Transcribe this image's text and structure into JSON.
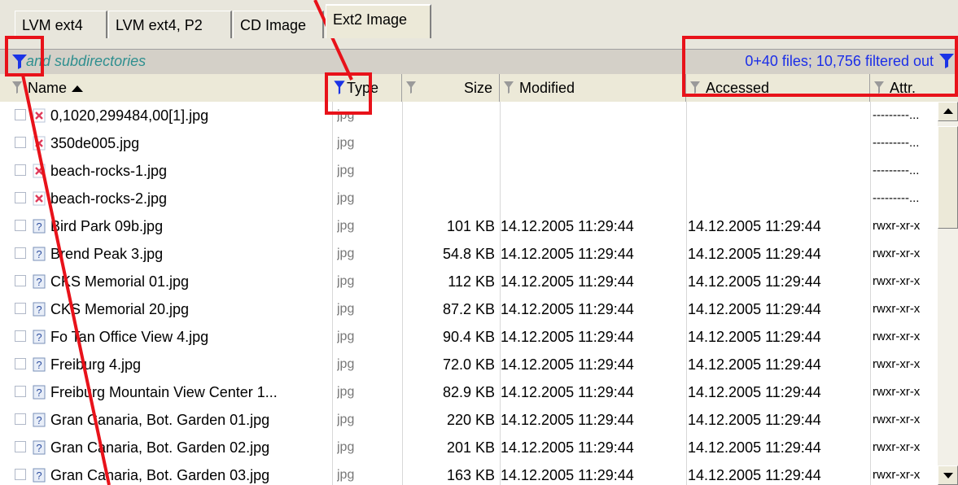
{
  "tabs": [
    {
      "label": "LVM ext4",
      "active": false
    },
    {
      "label": "LVM ext4, P2",
      "active": false
    },
    {
      "label": "CD Image",
      "active": false
    },
    {
      "label": "Ext2 Image",
      "active": true
    }
  ],
  "filter_bar": {
    "left_text": "and subdirectories",
    "right_text": "0+40 files; 10,756 filtered out",
    "funnel_color": "#1a33e6"
  },
  "columns": {
    "name": "Name",
    "type": "Type",
    "size": "Size",
    "modified": "Modified",
    "accessed": "Accessed",
    "attr": "Attr."
  },
  "rows": [
    {
      "status": "x-icon",
      "name": "0,1020,299484,00[1].jpg",
      "type": "jpg",
      "size": "",
      "modified": "",
      "accessed": "",
      "attr": "---------..."
    },
    {
      "status": "x-icon",
      "name": "350de005.jpg",
      "type": "jpg",
      "size": "",
      "modified": "",
      "accessed": "",
      "attr": "---------..."
    },
    {
      "status": "x-icon",
      "name": "beach-rocks-1.jpg",
      "type": "jpg",
      "size": "",
      "modified": "",
      "accessed": "",
      "attr": "---------..."
    },
    {
      "status": "x-icon",
      "name": "beach-rocks-2.jpg",
      "type": "jpg",
      "size": "",
      "modified": "",
      "accessed": "",
      "attr": "---------..."
    },
    {
      "status": "question-icon",
      "name": "Bird Park 09b.jpg",
      "type": "jpg",
      "size": "101 KB",
      "modified": "14.12.2005  11:29:44",
      "accessed": "14.12.2005  11:29:44",
      "attr": "rwxr-xr-x"
    },
    {
      "status": "question-icon",
      "name": "Brend Peak 3.jpg",
      "type": "jpg",
      "size": "54.8 KB",
      "modified": "14.12.2005  11:29:44",
      "accessed": "14.12.2005  11:29:44",
      "attr": "rwxr-xr-x"
    },
    {
      "status": "question-icon",
      "name": "CKS Memorial 01.jpg",
      "type": "jpg",
      "size": "112 KB",
      "modified": "14.12.2005  11:29:44",
      "accessed": "14.12.2005  11:29:44",
      "attr": "rwxr-xr-x"
    },
    {
      "status": "question-icon",
      "name": "CKS Memorial 20.jpg",
      "type": "jpg",
      "size": "87.2 KB",
      "modified": "14.12.2005  11:29:44",
      "accessed": "14.12.2005  11:29:44",
      "attr": "rwxr-xr-x"
    },
    {
      "status": "question-icon",
      "name": "Fo Tan Office View 4.jpg",
      "type": "jpg",
      "size": "90.4 KB",
      "modified": "14.12.2005  11:29:44",
      "accessed": "14.12.2005  11:29:44",
      "attr": "rwxr-xr-x"
    },
    {
      "status": "question-icon",
      "name": "Freiburg 4.jpg",
      "type": "jpg",
      "size": "72.0 KB",
      "modified": "14.12.2005  11:29:44",
      "accessed": "14.12.2005  11:29:44",
      "attr": "rwxr-xr-x"
    },
    {
      "status": "question-icon",
      "name": "Freiburg Mountain View Center 1...",
      "type": "jpg",
      "size": "82.9 KB",
      "modified": "14.12.2005  11:29:44",
      "accessed": "14.12.2005  11:29:44",
      "attr": "rwxr-xr-x"
    },
    {
      "status": "question-icon",
      "name": "Gran Canaria, Bot. Garden 01.jpg",
      "type": "jpg",
      "size": "220 KB",
      "modified": "14.12.2005  11:29:44",
      "accessed": "14.12.2005  11:29:44",
      "attr": "rwxr-xr-x"
    },
    {
      "status": "question-icon",
      "name": "Gran Canaria, Bot. Garden 02.jpg",
      "type": "jpg",
      "size": "201 KB",
      "modified": "14.12.2005  11:29:44",
      "accessed": "14.12.2005  11:29:44",
      "attr": "rwxr-xr-x"
    },
    {
      "status": "question-icon",
      "name": "Gran Canaria, Bot. Garden 03.jpg",
      "type": "jpg",
      "size": "163 KB",
      "modified": "14.12.2005  11:29:44",
      "accessed": "14.12.2005  11:29:44",
      "attr": "rwxr-xr-x"
    }
  ],
  "colors": {
    "annotation": "#e8121a",
    "filter_active": "#1a33e6",
    "filter_inactive": "#9a9a9a"
  }
}
